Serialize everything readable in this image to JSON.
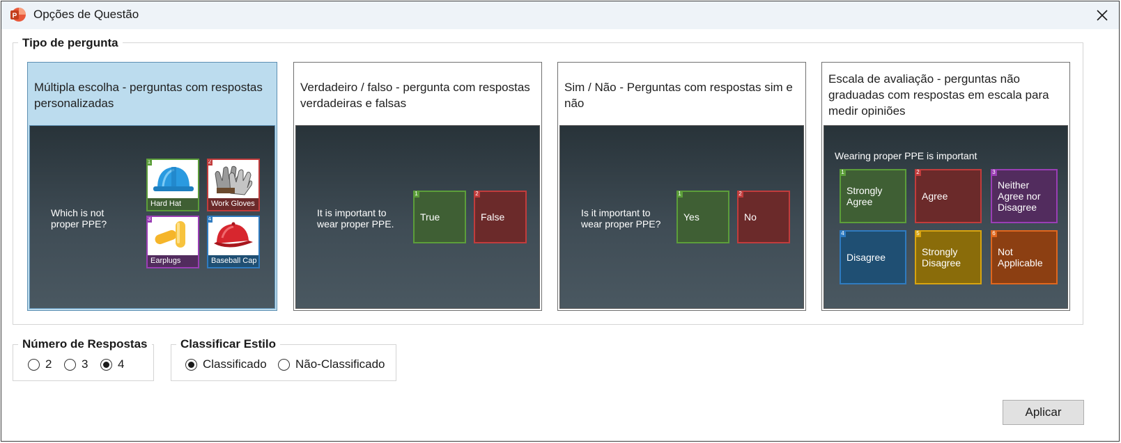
{
  "window": {
    "title": "Opções de Questão",
    "close_icon": "close-icon",
    "app_icon": "powerpoint-logo-icon"
  },
  "question_type": {
    "legend": "Tipo de pergunta",
    "cards": [
      {
        "id": "multiple-choice",
        "selected": true,
        "description": "Múltipla escolha - perguntas com respostas personalizadas",
        "preview": {
          "question": "Which is not proper PPE?",
          "answers": [
            {
              "num": "1",
              "label": "Hard Hat",
              "icon": "hard-hat-icon",
              "color": "#5c9e3a"
            },
            {
              "num": "2",
              "label": "Work Gloves",
              "icon": "work-gloves-icon",
              "color": "#c23c3c"
            },
            {
              "num": "3",
              "label": "Earplugs",
              "icon": "earplugs-icon",
              "color": "#9a3eb5"
            },
            {
              "num": "4",
              "label": "Baseball Cap",
              "icon": "baseball-cap-icon",
              "color": "#2f7bc0"
            }
          ]
        }
      },
      {
        "id": "true-false",
        "selected": false,
        "description": "Verdadeiro / falso - pergunta com respostas verdadeiras e falsas",
        "preview": {
          "question": "It is important to wear proper PPE.",
          "answers": [
            {
              "num": "1",
              "label": "True"
            },
            {
              "num": "2",
              "label": "False"
            }
          ]
        }
      },
      {
        "id": "yes-no",
        "selected": false,
        "description": "Sim / Não - Perguntas com respostas sim e não",
        "preview": {
          "question": "Is it important to wear proper PPE?",
          "answers": [
            {
              "num": "1",
              "label": "Yes"
            },
            {
              "num": "2",
              "label": "No"
            }
          ]
        }
      },
      {
        "id": "rating-scale",
        "selected": false,
        "description": "Escala de avaliação - perguntas não graduadas com respostas em escala para medir opiniões",
        "preview": {
          "question": "Wearing proper PPE is important",
          "answers": [
            {
              "num": "1",
              "label": "Strongly Agree"
            },
            {
              "num": "2",
              "label": "Agree"
            },
            {
              "num": "3",
              "label": "Neither Agree nor Disagree"
            },
            {
              "num": "4",
              "label": "Disagree"
            },
            {
              "num": "5",
              "label": "Strongly Disagree"
            },
            {
              "num": "6",
              "label": "Not Applicable"
            }
          ]
        }
      }
    ]
  },
  "num_answers": {
    "legend": "Número de Respostas",
    "options": [
      {
        "label": "2",
        "checked": false
      },
      {
        "label": "3",
        "checked": false
      },
      {
        "label": "4",
        "checked": true
      }
    ]
  },
  "grading_style": {
    "legend": "Classificar Estilo",
    "options": [
      {
        "label": "Classificado",
        "checked": true
      },
      {
        "label": "Não-Classificado",
        "checked": false
      }
    ]
  },
  "apply_button": {
    "label": "Aplicar"
  }
}
